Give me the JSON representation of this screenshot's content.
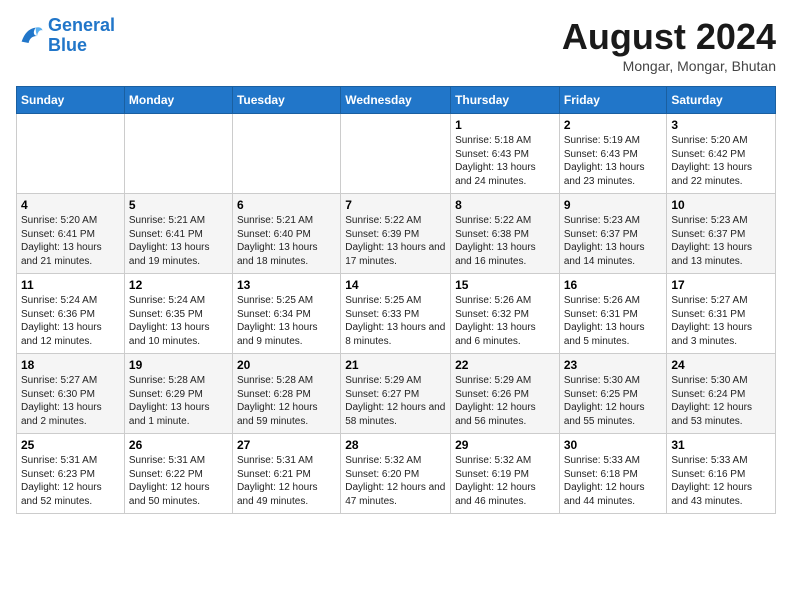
{
  "logo": {
    "line1": "General",
    "line2": "Blue"
  },
  "header": {
    "month": "August 2024",
    "location": "Mongar, Mongar, Bhutan"
  },
  "weekdays": [
    "Sunday",
    "Monday",
    "Tuesday",
    "Wednesday",
    "Thursday",
    "Friday",
    "Saturday"
  ],
  "weeks": [
    [
      {
        "day": "",
        "info": ""
      },
      {
        "day": "",
        "info": ""
      },
      {
        "day": "",
        "info": ""
      },
      {
        "day": "",
        "info": ""
      },
      {
        "day": "1",
        "info": "Sunrise: 5:18 AM\nSunset: 6:43 PM\nDaylight: 13 hours and 24 minutes."
      },
      {
        "day": "2",
        "info": "Sunrise: 5:19 AM\nSunset: 6:43 PM\nDaylight: 13 hours and 23 minutes."
      },
      {
        "day": "3",
        "info": "Sunrise: 5:20 AM\nSunset: 6:42 PM\nDaylight: 13 hours and 22 minutes."
      }
    ],
    [
      {
        "day": "4",
        "info": "Sunrise: 5:20 AM\nSunset: 6:41 PM\nDaylight: 13 hours and 21 minutes."
      },
      {
        "day": "5",
        "info": "Sunrise: 5:21 AM\nSunset: 6:41 PM\nDaylight: 13 hours and 19 minutes."
      },
      {
        "day": "6",
        "info": "Sunrise: 5:21 AM\nSunset: 6:40 PM\nDaylight: 13 hours and 18 minutes."
      },
      {
        "day": "7",
        "info": "Sunrise: 5:22 AM\nSunset: 6:39 PM\nDaylight: 13 hours and 17 minutes."
      },
      {
        "day": "8",
        "info": "Sunrise: 5:22 AM\nSunset: 6:38 PM\nDaylight: 13 hours and 16 minutes."
      },
      {
        "day": "9",
        "info": "Sunrise: 5:23 AM\nSunset: 6:37 PM\nDaylight: 13 hours and 14 minutes."
      },
      {
        "day": "10",
        "info": "Sunrise: 5:23 AM\nSunset: 6:37 PM\nDaylight: 13 hours and 13 minutes."
      }
    ],
    [
      {
        "day": "11",
        "info": "Sunrise: 5:24 AM\nSunset: 6:36 PM\nDaylight: 13 hours and 12 minutes."
      },
      {
        "day": "12",
        "info": "Sunrise: 5:24 AM\nSunset: 6:35 PM\nDaylight: 13 hours and 10 minutes."
      },
      {
        "day": "13",
        "info": "Sunrise: 5:25 AM\nSunset: 6:34 PM\nDaylight: 13 hours and 9 minutes."
      },
      {
        "day": "14",
        "info": "Sunrise: 5:25 AM\nSunset: 6:33 PM\nDaylight: 13 hours and 8 minutes."
      },
      {
        "day": "15",
        "info": "Sunrise: 5:26 AM\nSunset: 6:32 PM\nDaylight: 13 hours and 6 minutes."
      },
      {
        "day": "16",
        "info": "Sunrise: 5:26 AM\nSunset: 6:31 PM\nDaylight: 13 hours and 5 minutes."
      },
      {
        "day": "17",
        "info": "Sunrise: 5:27 AM\nSunset: 6:31 PM\nDaylight: 13 hours and 3 minutes."
      }
    ],
    [
      {
        "day": "18",
        "info": "Sunrise: 5:27 AM\nSunset: 6:30 PM\nDaylight: 13 hours and 2 minutes."
      },
      {
        "day": "19",
        "info": "Sunrise: 5:28 AM\nSunset: 6:29 PM\nDaylight: 13 hours and 1 minute."
      },
      {
        "day": "20",
        "info": "Sunrise: 5:28 AM\nSunset: 6:28 PM\nDaylight: 12 hours and 59 minutes."
      },
      {
        "day": "21",
        "info": "Sunrise: 5:29 AM\nSunset: 6:27 PM\nDaylight: 12 hours and 58 minutes."
      },
      {
        "day": "22",
        "info": "Sunrise: 5:29 AM\nSunset: 6:26 PM\nDaylight: 12 hours and 56 minutes."
      },
      {
        "day": "23",
        "info": "Sunrise: 5:30 AM\nSunset: 6:25 PM\nDaylight: 12 hours and 55 minutes."
      },
      {
        "day": "24",
        "info": "Sunrise: 5:30 AM\nSunset: 6:24 PM\nDaylight: 12 hours and 53 minutes."
      }
    ],
    [
      {
        "day": "25",
        "info": "Sunrise: 5:31 AM\nSunset: 6:23 PM\nDaylight: 12 hours and 52 minutes."
      },
      {
        "day": "26",
        "info": "Sunrise: 5:31 AM\nSunset: 6:22 PM\nDaylight: 12 hours and 50 minutes."
      },
      {
        "day": "27",
        "info": "Sunrise: 5:31 AM\nSunset: 6:21 PM\nDaylight: 12 hours and 49 minutes."
      },
      {
        "day": "28",
        "info": "Sunrise: 5:32 AM\nSunset: 6:20 PM\nDaylight: 12 hours and 47 minutes."
      },
      {
        "day": "29",
        "info": "Sunrise: 5:32 AM\nSunset: 6:19 PM\nDaylight: 12 hours and 46 minutes."
      },
      {
        "day": "30",
        "info": "Sunrise: 5:33 AM\nSunset: 6:18 PM\nDaylight: 12 hours and 44 minutes."
      },
      {
        "day": "31",
        "info": "Sunrise: 5:33 AM\nSunset: 6:16 PM\nDaylight: 12 hours and 43 minutes."
      }
    ]
  ]
}
